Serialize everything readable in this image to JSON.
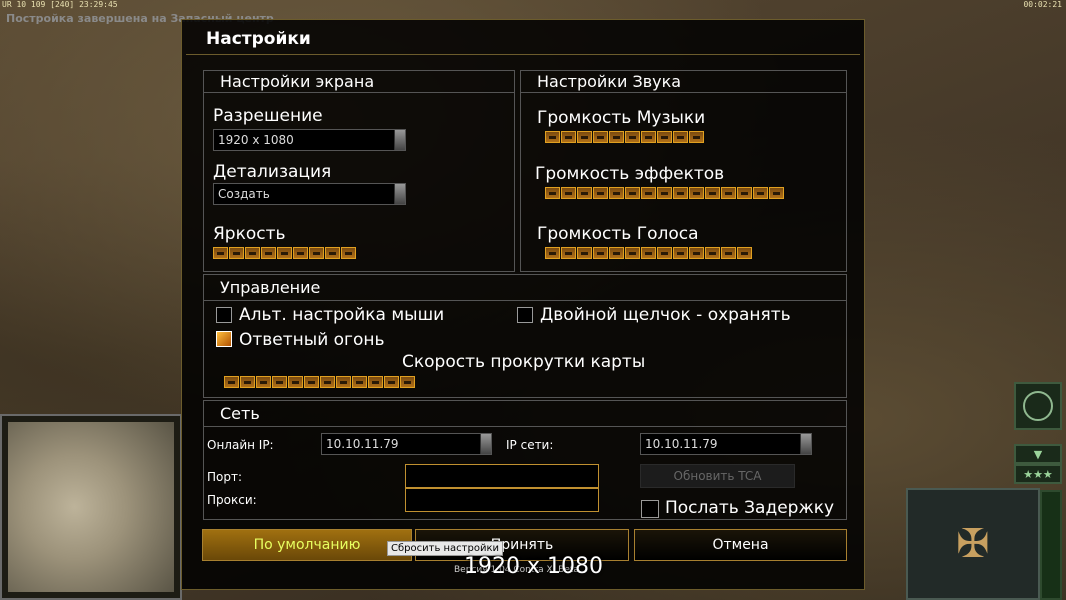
{
  "hud": {
    "top_left": "UR 10 109 [240] 23:29:45",
    "top_right": "00:02:21",
    "message": "Постройка завершена на Запасный центр"
  },
  "dialog": {
    "title": "Настройки",
    "display": {
      "title": "Настройки экрана",
      "resolution_label": "Разрешение",
      "resolution_value": "1920 x 1080",
      "detail_label": "Детализация",
      "detail_value": "Создать",
      "brightness_label": "Яркость",
      "brightness_level": 9
    },
    "sound": {
      "title": "Настройки Звука",
      "music_label": "Громкость Музыки",
      "music_level": 10,
      "effects_label": "Громкость эффектов",
      "effects_level": 15,
      "voice_label": "Громкость Голоса",
      "voice_level": 13
    },
    "controls": {
      "title": "Управление",
      "alt_mouse_label": "Альт. настройка мыши",
      "alt_mouse_checked": false,
      "double_click_label": "Двойной щелчок - охранять",
      "double_click_checked": false,
      "return_fire_label": "Ответный огонь",
      "return_fire_checked": true,
      "scroll_label": "Скорость прокрутки карты",
      "scroll_level": 12
    },
    "network": {
      "title": "Сеть",
      "online_ip_label": "Онлайн IP:",
      "online_ip_value": "10.10.11.79",
      "lan_ip_label": "IP сети:",
      "lan_ip_value": "10.10.11.79",
      "port_label": "Порт:",
      "port_value": "",
      "proxy_label": "Прокси:",
      "proxy_value": "",
      "update_tca_label": "Обновить TCA",
      "send_delay_label": "Послать Задержку",
      "send_delay_checked": false
    },
    "buttons": {
      "default_label": "По умолчанию",
      "accept_label": "Принять",
      "cancel_label": "Отмена"
    },
    "tooltip": "Сбросить настройки",
    "resolution_overlay": "1920 x 1080",
    "version": "Версия 1.04 Contra XI Beta"
  }
}
